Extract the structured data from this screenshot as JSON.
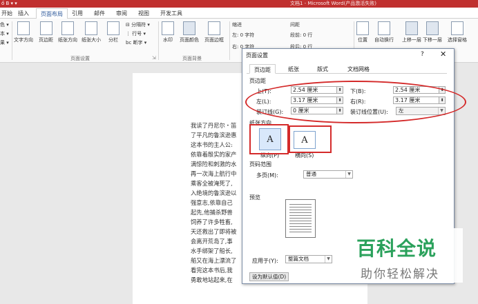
{
  "titlebar": {
    "quick_access": "ő B ▾ ▾",
    "title": "文档1 - Microsoft Word(产品激活失败)"
  },
  "menubar": {
    "tabs": [
      "开始",
      "插入",
      "页面布局",
      "引用",
      "邮件",
      "审阅",
      "视图",
      "开发工具"
    ]
  },
  "ribbon": {
    "left_cut": [
      "色 ▾",
      "本 ▾",
      "果 ▾"
    ],
    "page_setup_buttons": [
      "文字方向",
      "页边距",
      "纸张方向",
      "纸张大小",
      "分栏"
    ],
    "breaks": "分隔符 ▾",
    "line_numbers": "行号 ▾",
    "hyphenation": "断字 ▾",
    "page_setup_group": "页面设置",
    "background_buttons": [
      "水印",
      "页面颜色",
      "页面边框"
    ],
    "background_group": "页面背景",
    "indent_title": "缩进",
    "indent_left": "左: 0 字符",
    "indent_right": "右: 0 字符",
    "spacing_title": "间距",
    "spacing_before": "段前: 0 行",
    "spacing_after": "段后: 0 行",
    "arrange_buttons": [
      "位置",
      "自动换行",
      "上移一层",
      "下移一层",
      "选择窗格"
    ]
  },
  "document": {
    "lines": [
      "我读了丹尼尔・笛",
      "了平凡的鲁滨逊惠",
      "这本书的主人公:",
      "依靠着殷实的家产",
      "满惊险和刺激的水",
      "再一次海上航行中",
      "乘客全被淹死了,",
      "入绝境的鲁滨逊以",
      "强意志,依靠自己",
      "起先,他捕杀野兽",
      "饲养了许多牲畜,",
      "天还救出了即将被",
      "会离开荒岛了,事",
      "水手绑架了船长,",
      "船又在海上漂流了",
      "看完这本书后,我",
      "勇敢地站起来,在"
    ]
  },
  "dialog": {
    "title": "页面设置",
    "help": "?",
    "close": "✕",
    "tabs": [
      "页边距",
      "纸张",
      "版式",
      "文档网格"
    ],
    "margins_section": "页边距",
    "top_label": "上(T):",
    "top_value": "2.54 厘米",
    "bottom_label": "下(B):",
    "bottom_value": "2.54 厘米",
    "left_label": "左(L):",
    "left_value": "3.17 厘米",
    "right_label": "右(R):",
    "right_value": "3.17 厘米",
    "gutter_label": "装订线(G):",
    "gutter_value": "0 厘米",
    "gutter_pos_label": "装订线位置(U):",
    "gutter_pos_value": "左",
    "orientation_section": "纸张方向",
    "portrait_label": "纵向(P)",
    "landscape_label": "横向(S)",
    "pages_section": "页码范围",
    "multiple_pages_label": "多页(M):",
    "multiple_pages_value": "普通",
    "preview_section": "预览",
    "apply_label": "应用于(Y):",
    "apply_value": "整篇文档",
    "default_button": "设为默认值(D)"
  },
  "watermark": {
    "brand": "百科全说",
    "sub": "助你轻松解决"
  },
  "colors": {
    "title_bar": "#c0302f",
    "annotation": "#d42a2a",
    "watermark_green": "#2aa15b"
  }
}
